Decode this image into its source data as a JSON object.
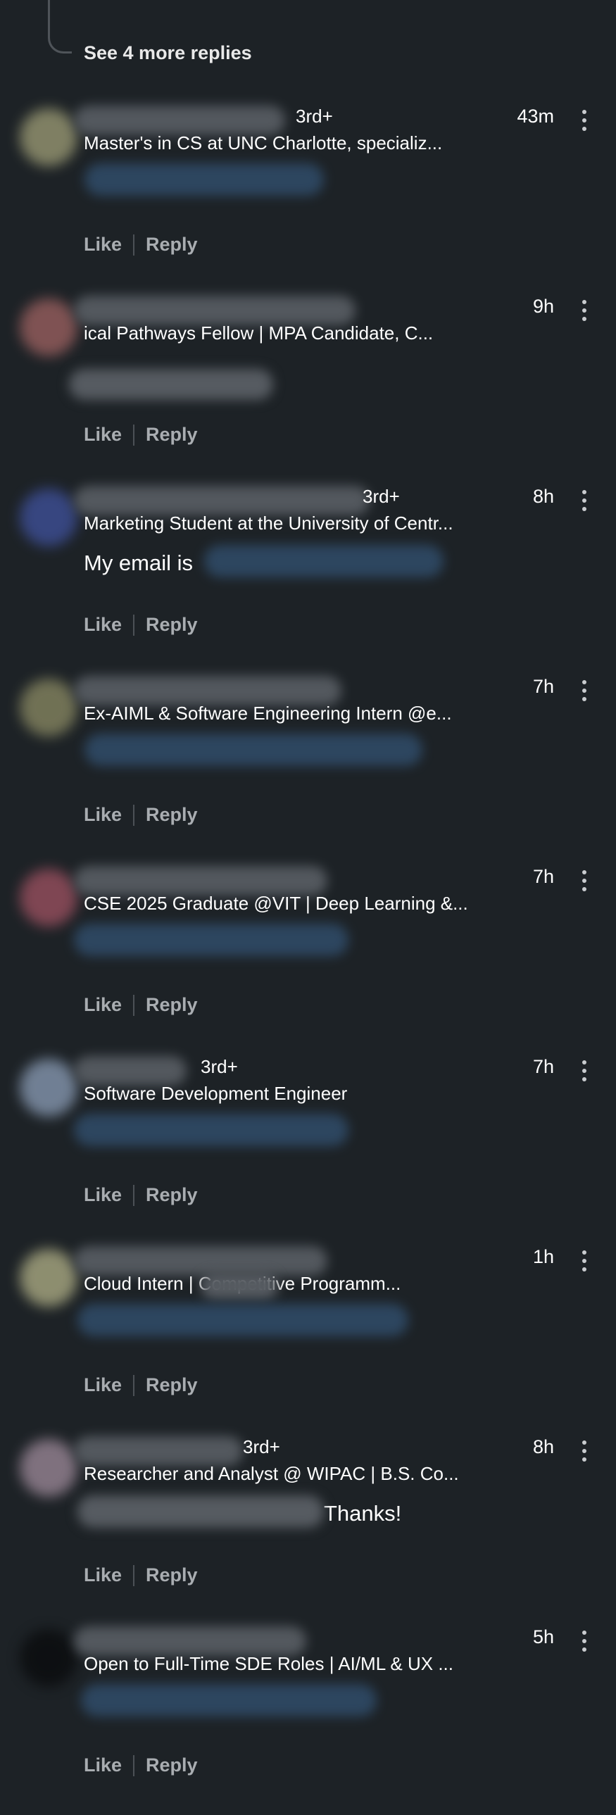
{
  "thread": {
    "see_more_label": "See 4 more replies"
  },
  "actions": {
    "like_label": "Like",
    "reply_label": "Reply"
  },
  "comments": [
    {
      "degree": "3rd+",
      "headline": "Master's in CS at UNC Charlotte, specializ...",
      "time": "43m",
      "body": ""
    },
    {
      "degree": "",
      "headline": "ical Pathways Fellow | MPA Candidate, C...",
      "time": "9h",
      "body": ""
    },
    {
      "degree": "3rd+",
      "headline": "Marketing Student at the University of Centr...",
      "time": "8h",
      "body": "My email is"
    },
    {
      "degree": "",
      "headline": "Ex-AIML & Software Engineering Intern @e...",
      "time": "7h",
      "body": ""
    },
    {
      "degree": "",
      "headline": "CSE 2025 Graduate @VIT | Deep Learning &...",
      "time": "7h",
      "body": ""
    },
    {
      "degree": "3rd+",
      "headline": "Software Development Engineer",
      "time": "7h",
      "body": ""
    },
    {
      "degree": "",
      "headline": "Cloud Intern | Competitive Programm...",
      "time": "1h",
      "body": ""
    },
    {
      "degree": "3rd+",
      "headline": "Researcher and Analyst @ WIPAC | B.S. Co...",
      "time": "8h",
      "body": "Thanks!"
    },
    {
      "degree": "",
      "headline": "Open to Full-Time SDE Roles | AI/ML & UX ...",
      "time": "5h",
      "body": ""
    }
  ]
}
